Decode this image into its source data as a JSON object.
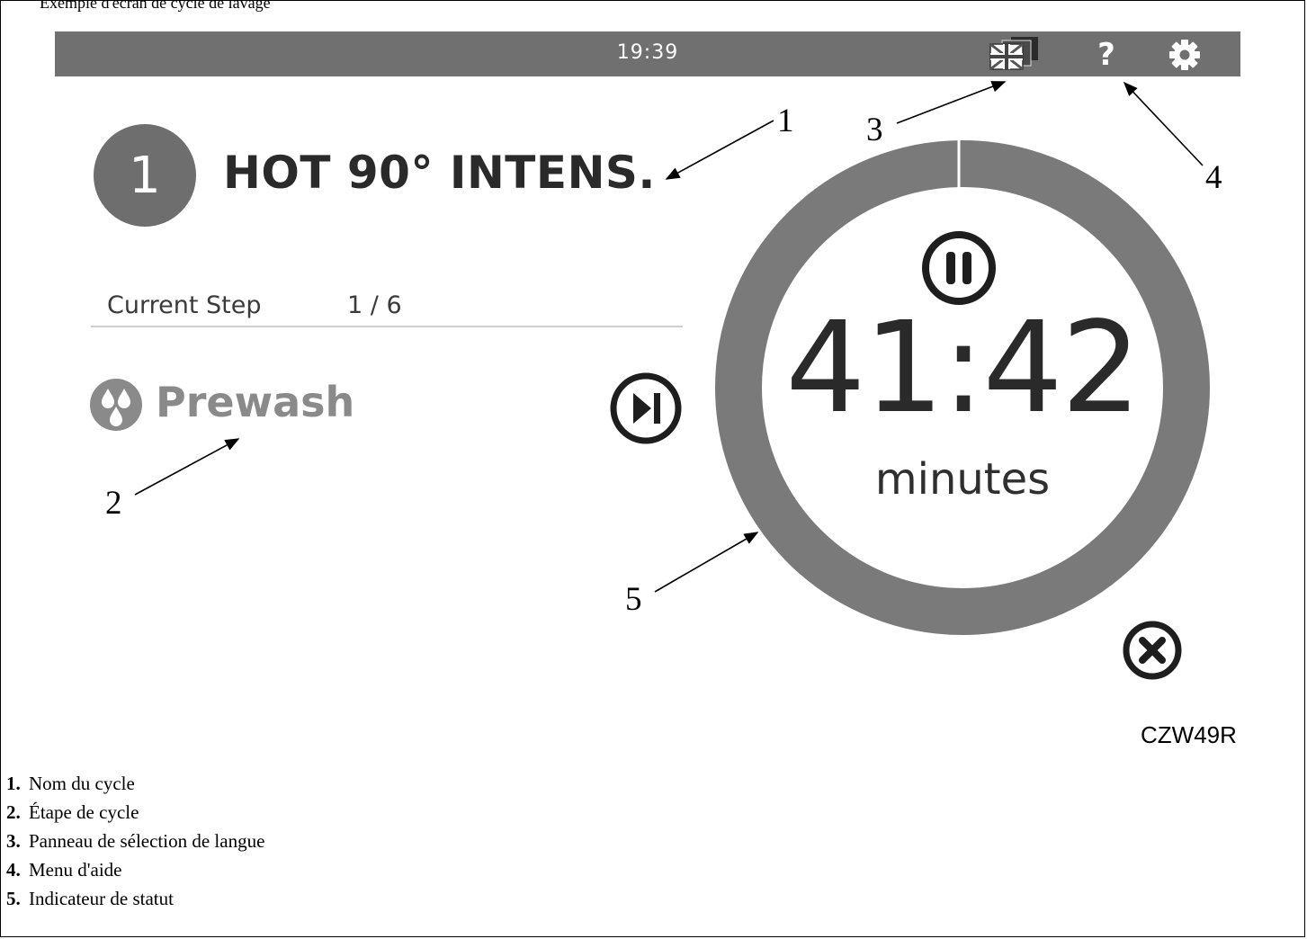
{
  "header": {
    "cut_text": "Exemple d'écran de cycle de lavage"
  },
  "topbar": {
    "time": "19:39",
    "language_icon": "uk-flag-language-icon",
    "help_label": "?",
    "settings_icon": "gear-icon"
  },
  "cycle": {
    "number": "1",
    "name": "HOT 90° INTENS."
  },
  "step": {
    "label": "Current Step",
    "value": "1 / 6",
    "name": "Prewash",
    "icon": "water-drops-icon"
  },
  "timer": {
    "value": "41:42",
    "unit": "minutes",
    "progress": 0.0
  },
  "controls": {
    "pause_icon": "pause-icon",
    "skip_icon": "skip-next-icon",
    "cancel_icon": "close-icon"
  },
  "figure_code": "CZW49R",
  "callouts": [
    "1",
    "2",
    "3",
    "4",
    "5"
  ],
  "legend": [
    {
      "num": "1.",
      "text": "Nom du cycle"
    },
    {
      "num": "2.",
      "text": "Étape de cycle"
    },
    {
      "num": "3.",
      "text": "Panneau de sélection de langue"
    },
    {
      "num": "4.",
      "text": "Menu d'aide"
    },
    {
      "num": "5.",
      "text": "Indicateur de statut"
    }
  ],
  "colors": {
    "topbar": "#707070",
    "ring": "#7a7a7a",
    "text_dark": "#2a2a2a",
    "step_text": "#8a8a8a"
  }
}
